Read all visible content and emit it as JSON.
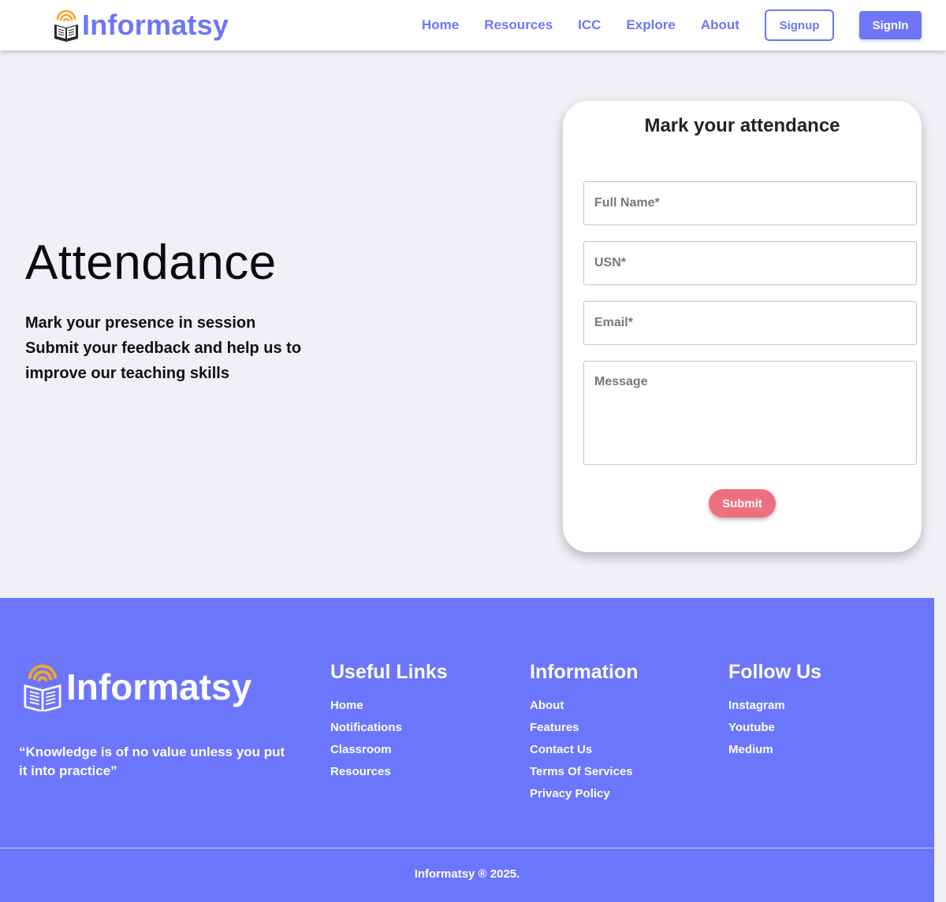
{
  "brand": {
    "name": "Informatsy"
  },
  "nav": {
    "links": [
      "Home",
      "Resources",
      "ICC",
      "Explore",
      "About"
    ],
    "signup": "Signup",
    "signin": "SignIn"
  },
  "hero": {
    "title": "Attendance",
    "lines": [
      "Mark your presence in session",
      "Submit your feedback and help us to",
      "improve our teaching skills"
    ]
  },
  "form": {
    "title": "Mark your attendance",
    "full_name_placeholder": "Full Name*",
    "usn_placeholder": "USN*",
    "email_placeholder": "Email*",
    "message_placeholder": "Message",
    "submit": "Submit"
  },
  "footer": {
    "brand": "Informatsy",
    "quote": "“Knowledge is of no value unless you put it into practice”",
    "useful_links": {
      "heading": "Useful Links",
      "items": [
        "Home",
        "Notifications",
        "Classroom",
        "Resources"
      ]
    },
    "information": {
      "heading": "Information",
      "items": [
        "About",
        "Features",
        "Contact Us",
        "Terms Of Services",
        "Privacy Policy"
      ]
    },
    "follow_us": {
      "heading": "Follow Us",
      "items": [
        "Instagram",
        "Youtube",
        "Medium"
      ]
    },
    "copyright": "Informatsy ® 2025."
  },
  "colors": {
    "accent": "#6c76f6",
    "footer_bg": "#6c76fd",
    "submit": "#ee6f80",
    "logo_arc": "#f5a623",
    "page_bg": "#f0f0f7"
  }
}
